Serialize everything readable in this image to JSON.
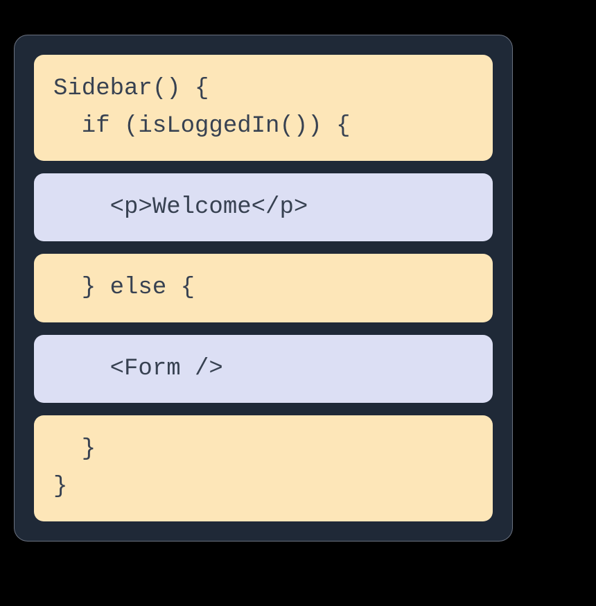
{
  "code": {
    "block1": {
      "line1": "Sidebar() {",
      "line2": "  if (isLoggedIn()) {"
    },
    "block2": {
      "line1": "    <p>Welcome</p>"
    },
    "block3": {
      "line1": "  } else {"
    },
    "block4": {
      "line1": "    <Form />"
    },
    "block5": {
      "line1": "  }",
      "line2": "}"
    }
  }
}
